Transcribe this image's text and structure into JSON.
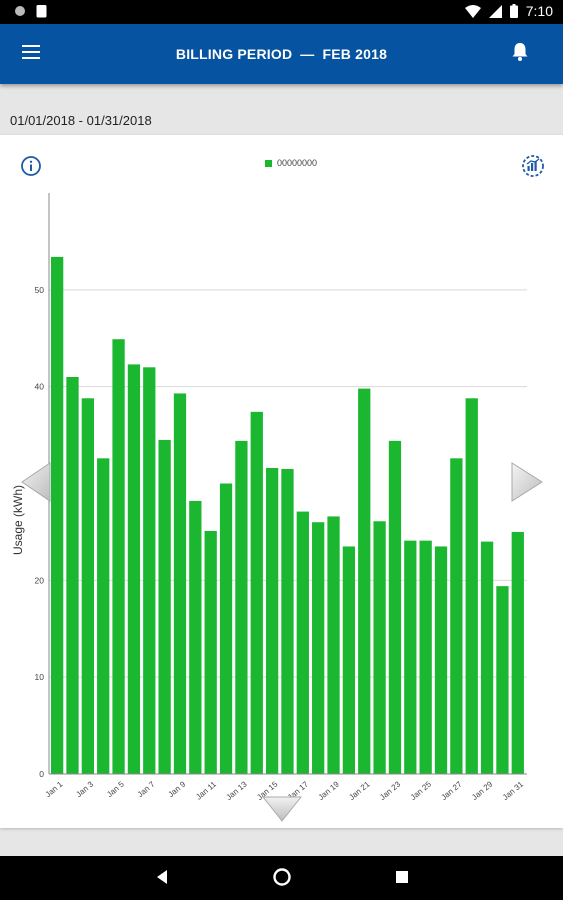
{
  "status_bar": {
    "time": "7:10"
  },
  "app_bar": {
    "title_left": "BILLING PERIOD",
    "title_right": "FEB 2018"
  },
  "date_range": "01/01/2018 - 01/31/2018",
  "legend_label": "00000000",
  "colors": {
    "app_bar": "#0553a1",
    "bar": "#1bb730",
    "grid": "#d9d9d9"
  },
  "icons": {
    "menu": "menu-icon",
    "bell": "bell-icon",
    "info": "info-icon",
    "chart_type": "chart-type-icon",
    "prev": "chevron-left-icon",
    "next": "chevron-right-icon",
    "down": "chevron-down-icon"
  },
  "chart_data": {
    "type": "bar",
    "title": "",
    "xlabel": "",
    "ylabel": "Usage (kWh)",
    "ylim": [
      0,
      60
    ],
    "yticks": [
      0,
      10,
      20,
      40,
      50
    ],
    "grid": true,
    "legend": "top-center",
    "categories": [
      "Jan 1",
      "Jan 2",
      "Jan 3",
      "Jan 4",
      "Jan 5",
      "Jan 6",
      "Jan 7",
      "Jan 8",
      "Jan 9",
      "Jan 10",
      "Jan 11",
      "Jan 12",
      "Jan 13",
      "Jan 14",
      "Jan 15",
      "Jan 16",
      "Jan 17",
      "Jan 18",
      "Jan 19",
      "Jan 20",
      "Jan 21",
      "Jan 22",
      "Jan 23",
      "Jan 24",
      "Jan 25",
      "Jan 26",
      "Jan 27",
      "Jan 28",
      "Jan 29",
      "Jan 30",
      "Jan 31"
    ],
    "xtick_labels": [
      "Jan 1",
      "Jan 3",
      "Jan 5",
      "Jan 7",
      "Jan 9",
      "Jan 11",
      "Jan 13",
      "Jan 15",
      "Jan 17",
      "Jan 19",
      "Jan 21",
      "Jan 23",
      "Jan 25",
      "Jan 27",
      "Jan 29",
      "Jan 31"
    ],
    "series": [
      {
        "values": [
          53.4,
          41.0,
          38.8,
          32.6,
          44.9,
          42.3,
          42.0,
          34.5,
          39.3,
          28.2,
          25.1,
          30.0,
          34.4,
          37.4,
          31.6,
          31.5,
          27.1,
          26.0,
          26.6,
          23.5,
          39.8,
          26.1,
          34.4,
          24.1,
          24.1,
          23.5,
          32.6,
          38.8,
          24.0,
          19.4,
          25.0
        ]
      }
    ]
  }
}
